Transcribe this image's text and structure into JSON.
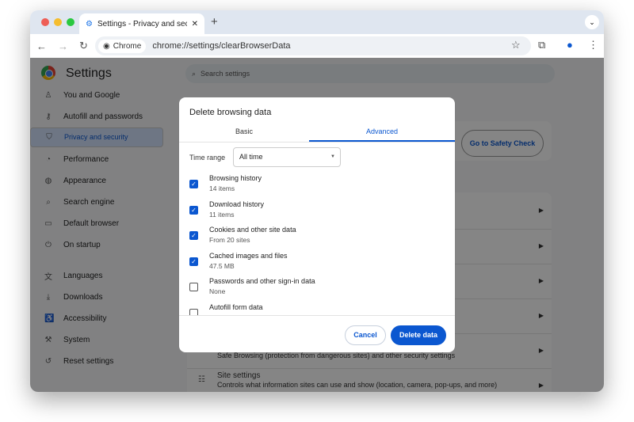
{
  "browser": {
    "tab_title": "Settings - Privacy and security",
    "url_chip": "Chrome",
    "url": "chrome://settings/clearBrowserData"
  },
  "settings": {
    "title": "Settings",
    "search_placeholder": "Search settings",
    "nav": [
      {
        "label": "You and Google",
        "icon": "person-icon"
      },
      {
        "label": "Autofill and passwords",
        "icon": "key-icon"
      },
      {
        "label": "Privacy and security",
        "icon": "shield-icon",
        "selected": true
      },
      {
        "label": "Performance",
        "icon": "gauge-icon"
      },
      {
        "label": "Appearance",
        "icon": "palette-icon"
      },
      {
        "label": "Search engine",
        "icon": "search-icon"
      },
      {
        "label": "Default browser",
        "icon": "browser-icon"
      },
      {
        "label": "On startup",
        "icon": "power-icon"
      },
      {
        "label": "Languages",
        "icon": "translate-icon"
      },
      {
        "label": "Downloads",
        "icon": "download-icon"
      },
      {
        "label": "Accessibility",
        "icon": "accessibility-icon"
      },
      {
        "label": "System",
        "icon": "wrench-icon"
      },
      {
        "label": "Reset settings",
        "icon": "reset-icon"
      }
    ],
    "safety_check_button": "Go to Safety Check",
    "security_desc": "Safe Browsing (protection from dangerous sites) and other security settings",
    "site_settings_title": "Site settings",
    "site_settings_desc": "Controls what information sites can use and show (location, camera, pop-ups, and more)"
  },
  "dialog": {
    "title": "Delete browsing data",
    "tabs": [
      "Basic",
      "Advanced"
    ],
    "active_tab": "Advanced",
    "time_range_label": "Time range",
    "time_range_value": "All time",
    "items": [
      {
        "label": "Browsing history",
        "sub": "14 items",
        "checked": true
      },
      {
        "label": "Download history",
        "sub": "11 items",
        "checked": true
      },
      {
        "label": "Cookies and other site data",
        "sub": "From 20 sites",
        "checked": true
      },
      {
        "label": "Cached images and files",
        "sub": "47.5 MB",
        "checked": true
      },
      {
        "label": "Passwords and other sign-in data",
        "sub": "None",
        "checked": false
      },
      {
        "label": "Autofill form data",
        "sub": "",
        "checked": false
      }
    ],
    "cancel": "Cancel",
    "delete": "Delete data"
  },
  "colors": {
    "accent": "#0b57d0"
  }
}
